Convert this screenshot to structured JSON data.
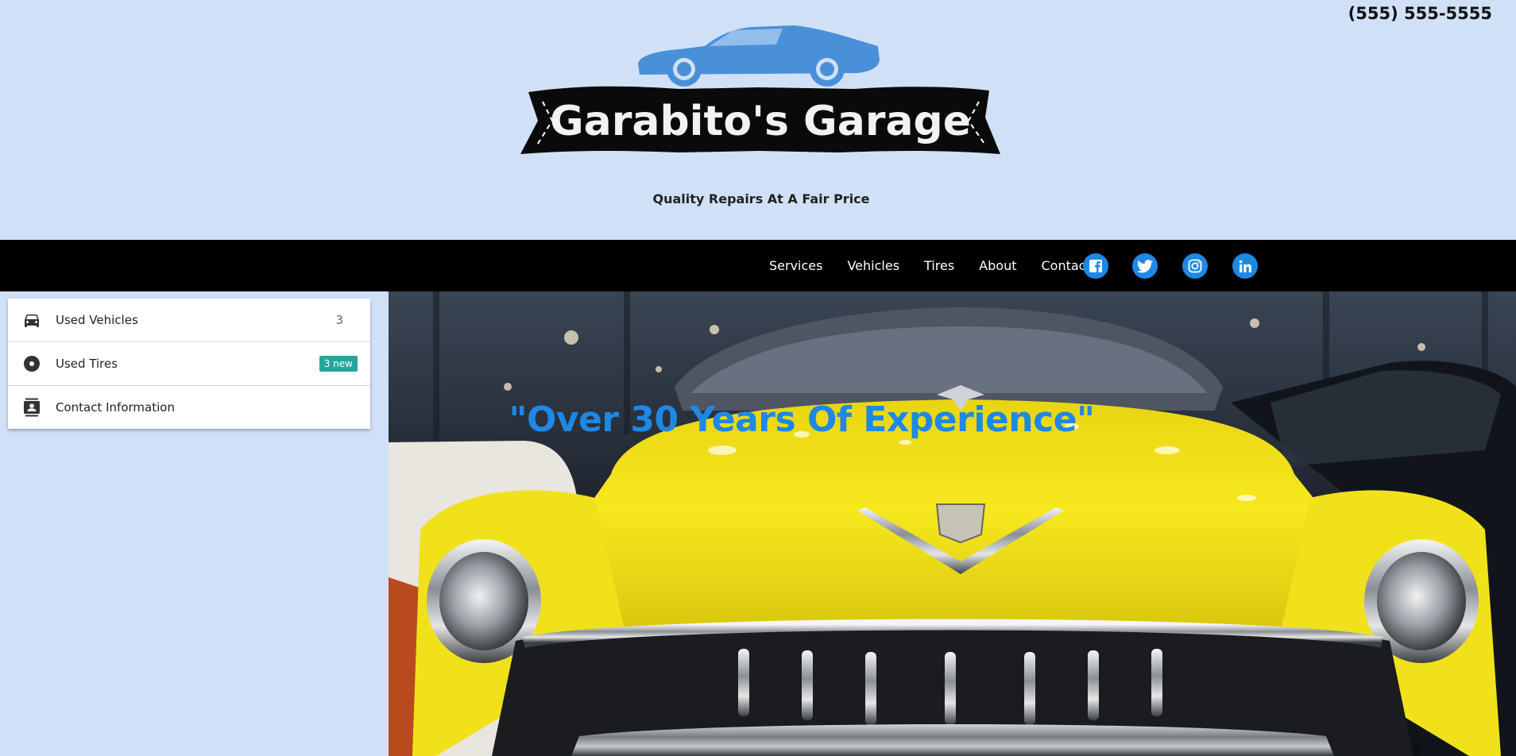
{
  "header": {
    "phone": "(555) 555-5555",
    "logo_text": "Garabito's Garage",
    "tagline": "Quality Repairs At A Fair Price"
  },
  "nav": {
    "links": [
      "Services",
      "Vehicles",
      "Tires",
      "About",
      "Contact"
    ],
    "social": [
      "facebook-icon",
      "twitter-icon",
      "instagram-icon",
      "linkedin-icon"
    ]
  },
  "sidebar": {
    "items": [
      {
        "label": "Used Vehicles",
        "icon": "car-icon",
        "count": "3"
      },
      {
        "label": "Used Tires",
        "icon": "tire-icon",
        "badge": "3 new"
      },
      {
        "label": "Contact Information",
        "icon": "contact-card-icon"
      }
    ]
  },
  "hero": {
    "quote": "\"Over 30 Years Of Experience\""
  },
  "colors": {
    "page_bg": "#d0e1f7",
    "nav_bg": "#000000",
    "accent": "#1e88e5",
    "badge": "#26a69a",
    "car_yellow": "#f4e21c"
  }
}
